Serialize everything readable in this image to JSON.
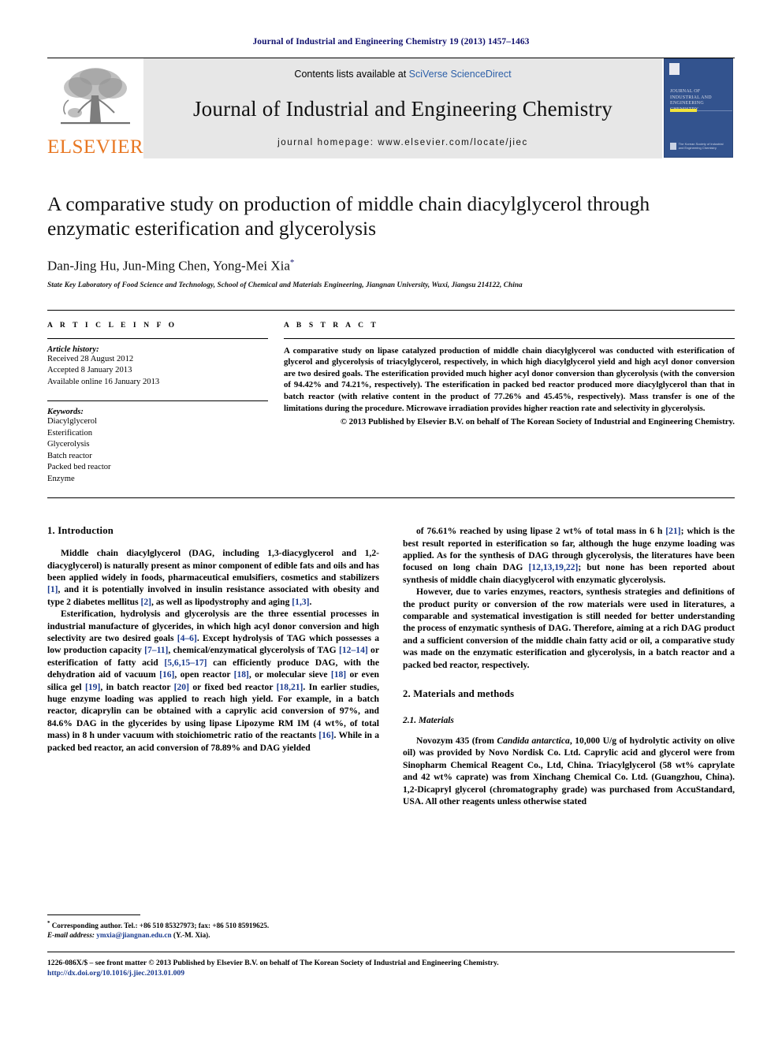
{
  "running_head": "Journal of Industrial and Engineering Chemistry 19 (2013) 1457–1463",
  "masthead": {
    "contents_prefix": "Contents lists available at ",
    "sciverse": "SciVerse ScienceDirect",
    "journal_name": "Journal of Industrial and Engineering Chemistry",
    "homepage": "journal homepage: www.elsevier.com/locate/jiec",
    "publisher_wordmark": "ELSEVIER",
    "cover_title": "JOURNAL OF INDUSTRIAL AND ENGINEERING CHEMISTRY",
    "cover_footer": "The Korean Society of Industrial and Engineering Chemistry"
  },
  "article": {
    "title": "A comparative study on production of middle chain diacylglycerol through enzymatic esterification and glycerolysis",
    "authors": "Dan-Jing Hu, Jun-Ming Chen, Yong-Mei Xia",
    "author_marker": "*",
    "affiliation": "State Key Laboratory of Food Science and Technology, School of Chemical and Materials Engineering, Jiangnan University, Wuxi, Jiangsu 214122, China"
  },
  "article_info": {
    "heading": "A R T I C L E   I N F O",
    "history_label": "Article history:",
    "received": "Received 28 August 2012",
    "accepted": "Accepted 8 January 2013",
    "available": "Available online 16 January 2013",
    "keywords_label": "Keywords:",
    "keywords": [
      "Diacylglycerol",
      "Esterification",
      "Glycerolysis",
      "Batch reactor",
      "Packed bed reactor",
      "Enzyme"
    ]
  },
  "abstract": {
    "heading": "A B S T R A C T",
    "body": "A comparative study on lipase catalyzed production of middle chain diacylglycerol was conducted with esterification of glycerol and glycerolysis of triacylglycerol, respectively, in which high diacylglycerol yield and high acyl donor conversion are two desired goals. The esterification provided much higher acyl donor conversion than glycerolysis (with the conversion of 94.42% and 74.21%, respectively). The esterification in packed bed reactor produced more diacylglycerol than that in batch reactor (with relative content in the product of 77.26% and 45.45%, respectively). Mass transfer is one of the limitations during the procedure. Microwave irradiation provides higher reaction rate and selectivity in glycerolysis.",
    "copyright": "© 2013 Published by Elsevier B.V. on behalf of The Korean Society of Industrial and Engineering Chemistry."
  },
  "sections": {
    "introduction_heading": "1. Introduction",
    "intro_p1": "Middle chain diacylglycerol (DAG, including 1,3-diacyglycerol and 1,2-diacyglycerol) is naturally present as minor component of edible fats and oils and has been applied widely in foods, pharmaceutical emulsifiers, cosmetics and stabilizers [1], and it is potentially involved in insulin resistance associated with obesity and type 2 diabetes mellitus [2], as well as lipodystrophy and aging [1,3].",
    "intro_p2": "Esterification, hydrolysis and glycerolysis are the three essential processes in industrial manufacture of glycerides, in which high acyl donor conversion and high selectivity are two desired goals [4–6]. Except hydrolysis of TAG which possesses a low production capacity [7–11], chemical/enzymatical glycerolysis of TAG [12–14] or esterification of fatty acid [5,6,15–17] can efficiently produce DAG, with the dehydration aid of vacuum [16], open reactor [18], or molecular sieve [18] or even silica gel [19], in batch reactor [20] or fixed bed reactor [18,21]. In earlier studies, huge enzyme loading was applied to reach high yield. For example, in a batch reactor, dicaprylin can be obtained with a caprylic acid conversion of 97%, and 84.6% DAG in the glycerides by using lipase Lipozyme RM IM (4 wt%, of total mass) in 8 h under vacuum with stoichiometric ratio of the reactants [16]. While in a packed bed reactor, an acid conversion of 78.89% and DAG yielded",
    "intro_p3": "of 76.61% reached by using lipase 2 wt% of total mass in 6 h [21]; which is the best result reported in esterification so far, although the huge enzyme loading was applied. As for the synthesis of DAG through glycerolysis, the literatures have been focused on long chain DAG [12,13,19,22]; but none has been reported about synthesis of middle chain diacyglycerol with enzymatic glycerolysis.",
    "intro_p4": "However, due to varies enzymes, reactors, synthesis strategies and definitions of the product purity or conversion of the row materials were used in literatures, a comparable and systematical investigation is still needed for better understanding the process of enzymatic synthesis of DAG. Therefore, aiming at a rich DAG product and a sufficient conversion of the middle chain fatty acid or oil, a comparative study was made on the enzymatic esterification and glycerolysis, in a batch reactor and a packed bed reactor, respectively.",
    "methods_heading": "2. Materials and methods",
    "materials_heading": "2.1. Materials",
    "materials_p1": "Novozym 435 (from Candida antarctica, 10,000 U/g of hydrolytic activity on olive oil) was provided by Novo Nordisk Co. Ltd. Caprylic acid and glycerol were from Sinopharm Chemical Reagent Co., Ltd, China. Triacylglycerol (58 wt% caprylate and 42 wt% caprate) was from Xinchang Chemical Co. Ltd. (Guangzhou, China). 1,2-Dicapryl glycerol (chromatography grade) was purchased from AccuStandard, USA. All other reagents unless otherwise stated"
  },
  "footnote": {
    "marker": "*",
    "corresponding": "Corresponding author. Tel.: +86 510 85327973; fax: +86 510 85919625.",
    "email_label": "E-mail address:",
    "email": "ymxia@jiangnan.edu.cn",
    "email_suffix": "(Y.-M. Xia)."
  },
  "page_footer": {
    "front_matter": "1226-086X/$ – see front matter © 2013 Published by Elsevier B.V. on behalf of The Korean Society of Industrial and Engineering Chemistry.",
    "doi": "http://dx.doi.org/10.1016/j.jiec.2013.01.009"
  },
  "colors": {
    "link_blue": "#1a3a8f",
    "header_blue": "#10106e",
    "elsevier_orange": "#E87722",
    "masthead_gray": "#e7e7e7",
    "cover_blue": "#33538e",
    "cover_accent": "#f2e33a"
  }
}
